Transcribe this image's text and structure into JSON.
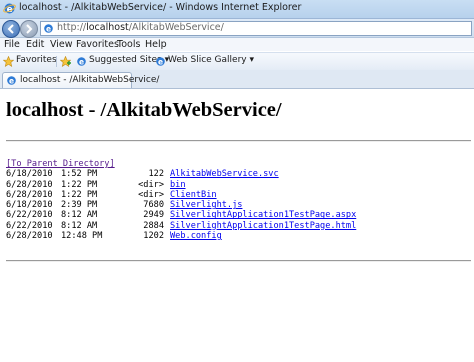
{
  "window": {
    "title": "localhost - /AlkitabWebService/ - Windows Internet Explorer"
  },
  "address": {
    "prefix": "http://",
    "host": "localhost",
    "path": "/AlkitabWebService/"
  },
  "menu": [
    "File",
    "Edit",
    "View",
    "Favorites",
    "Tools",
    "Help"
  ],
  "favorites_bar": {
    "favorites_label": "Favorites",
    "suggested_sites_label": "Suggested Sites",
    "web_slice_label": "Web Slice Gallery"
  },
  "tab": {
    "title": "localhost - /AlkitabWebService/"
  },
  "page": {
    "heading": "localhost - /AlkitabWebService/",
    "parent_link": "[To Parent Directory]",
    "entries": [
      {
        "date": "6/18/2010",
        "time": "1:52 PM",
        "size": "122",
        "name": "AlkitabWebService.svc"
      },
      {
        "date": "6/28/2010",
        "time": "1:22 PM",
        "size": "<dir>",
        "name": "bin"
      },
      {
        "date": "6/28/2010",
        "time": "1:22 PM",
        "size": "<dir>",
        "name": "ClientBin"
      },
      {
        "date": "6/18/2010",
        "time": "2:39 PM",
        "size": "7680",
        "name": "Silverlight.js"
      },
      {
        "date": "6/22/2010",
        "time": "8:12 AM",
        "size": "2949",
        "name": "SilverlightApplication1TestPage.aspx"
      },
      {
        "date": "6/22/2010",
        "time": "8:12 AM",
        "size": "2884",
        "name": "SilverlightApplication1TestPage.html"
      },
      {
        "date": "6/28/2010",
        "time": "12:48 PM",
        "size": "1202",
        "name": "Web.config"
      }
    ]
  }
}
